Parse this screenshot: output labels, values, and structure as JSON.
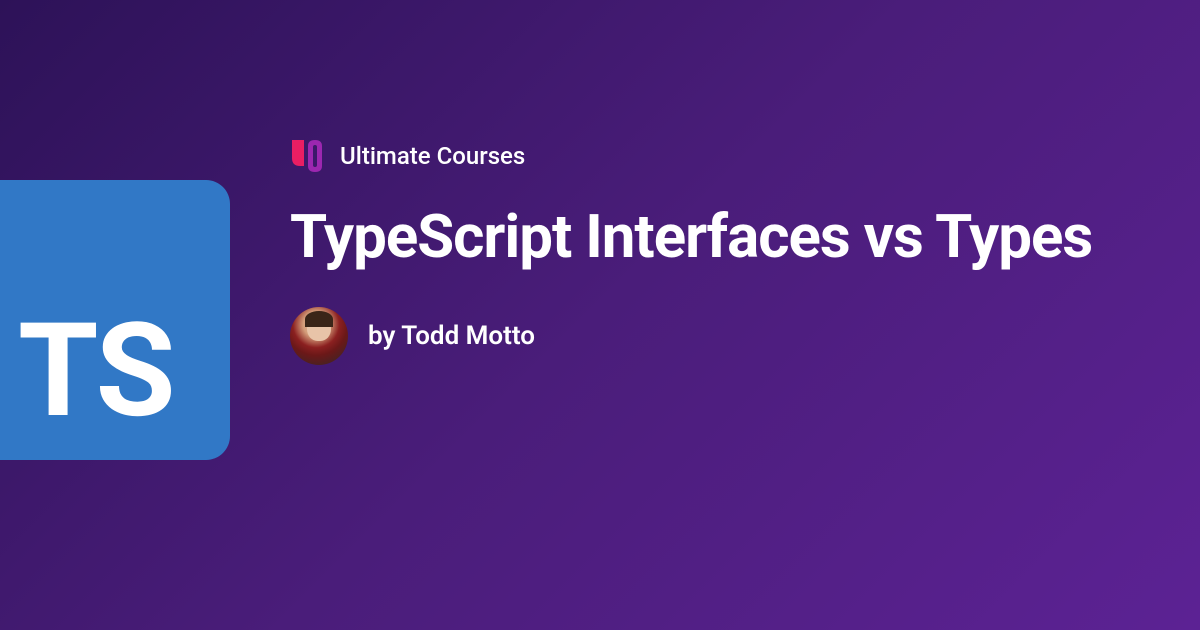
{
  "badge": {
    "text": "TS"
  },
  "brand": {
    "name": "Ultimate Courses"
  },
  "title": "TypeScript Interfaces vs Types",
  "author": {
    "byline": "by Todd Motto"
  }
}
